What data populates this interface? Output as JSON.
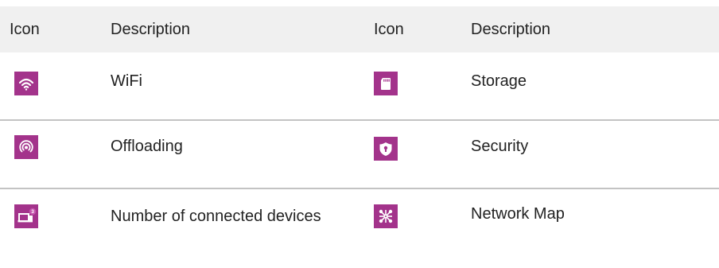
{
  "table": {
    "headers": {
      "icon_left": "Icon",
      "description_left": "Description",
      "icon_right": "Icon",
      "description_right": "Description"
    },
    "rows": [
      {
        "left": {
          "icon": "wifi-icon",
          "description": "WiFi"
        },
        "right": {
          "icon": "storage-sd-card-icon",
          "description": "Storage"
        }
      },
      {
        "left": {
          "icon": "offloading-icon",
          "description": "Offloading"
        },
        "right": {
          "icon": "security-shield-icon",
          "description": "Security"
        }
      },
      {
        "left": {
          "icon": "connected-devices-icon",
          "description": "Number of connected devices",
          "badge": "3"
        },
        "right": {
          "icon": "network-map-icon",
          "description": "Network Map"
        }
      }
    ]
  },
  "colors": {
    "icon_background": "#a3338b",
    "icon_foreground": "#ffffff",
    "header_background": "#f0f0f0",
    "divider": "#c3c3c3"
  }
}
